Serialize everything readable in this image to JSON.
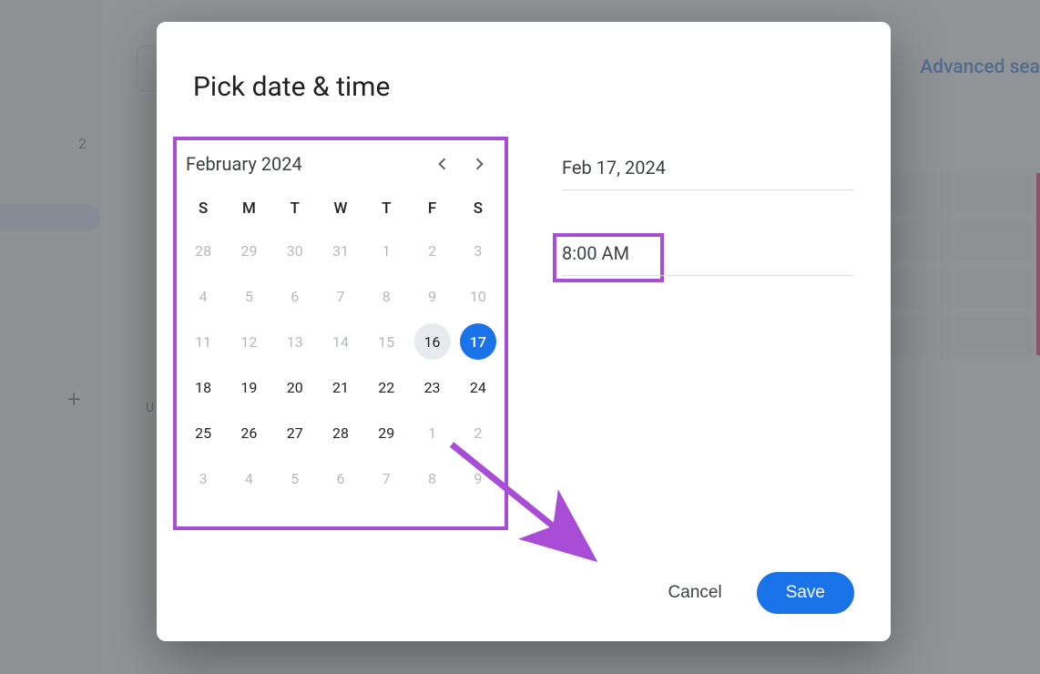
{
  "background": {
    "left_number": "2",
    "advanced_link": "Advanced sea",
    "list_label": "U"
  },
  "dialog": {
    "title": "Pick date & time",
    "calendar": {
      "month_label": "February 2024",
      "dow": [
        "S",
        "M",
        "T",
        "W",
        "T",
        "F",
        "S"
      ],
      "weeks": [
        [
          {
            "n": "28",
            "muted": true
          },
          {
            "n": "29",
            "muted": true
          },
          {
            "n": "30",
            "muted": true
          },
          {
            "n": "31",
            "muted": true
          },
          {
            "n": "1",
            "muted": true
          },
          {
            "n": "2",
            "muted": true
          },
          {
            "n": "3",
            "muted": true
          }
        ],
        [
          {
            "n": "4",
            "muted": true
          },
          {
            "n": "5",
            "muted": true
          },
          {
            "n": "6",
            "muted": true
          },
          {
            "n": "7",
            "muted": true
          },
          {
            "n": "8",
            "muted": true
          },
          {
            "n": "9",
            "muted": true
          },
          {
            "n": "10",
            "muted": true
          }
        ],
        [
          {
            "n": "11",
            "muted": true
          },
          {
            "n": "12",
            "muted": true
          },
          {
            "n": "13",
            "muted": true
          },
          {
            "n": "14",
            "muted": true
          },
          {
            "n": "15",
            "muted": true
          },
          {
            "n": "16",
            "today": true
          },
          {
            "n": "17",
            "sel": true
          }
        ],
        [
          {
            "n": "18"
          },
          {
            "n": "19"
          },
          {
            "n": "20"
          },
          {
            "n": "21"
          },
          {
            "n": "22"
          },
          {
            "n": "23"
          },
          {
            "n": "24"
          }
        ],
        [
          {
            "n": "25"
          },
          {
            "n": "26"
          },
          {
            "n": "27"
          },
          {
            "n": "28"
          },
          {
            "n": "29"
          },
          {
            "n": "1",
            "muted": true
          },
          {
            "n": "2",
            "muted": true
          }
        ],
        [
          {
            "n": "3",
            "muted": true
          },
          {
            "n": "4",
            "muted": true
          },
          {
            "n": "5",
            "muted": true
          },
          {
            "n": "6",
            "muted": true
          },
          {
            "n": "7",
            "muted": true
          },
          {
            "n": "8",
            "muted": true
          },
          {
            "n": "9",
            "muted": true
          }
        ]
      ]
    },
    "date_value": "Feb 17, 2024",
    "time_value": "8:00 AM",
    "cancel_label": "Cancel",
    "save_label": "Save"
  },
  "colors": {
    "accent": "#1a73e8",
    "highlight": "#a94cd6"
  }
}
